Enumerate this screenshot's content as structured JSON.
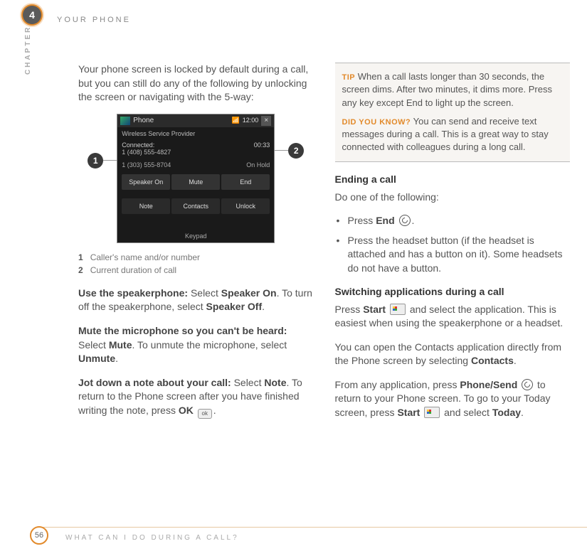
{
  "header": {
    "chapter_number": "4",
    "section_name": "YOUR PHONE",
    "chapter_label": "CHAPTER"
  },
  "left": {
    "intro": "Your phone screen is locked by default during a call, but you can still do any of the following by unlocking the screen or navigating with the 5-way:",
    "phone": {
      "title": "Phone",
      "clock": "12:00",
      "provider": "Wireless Service Provider",
      "connected_label": "Connected:",
      "duration": "00:33",
      "number_active": "1 (408) 555-4827",
      "number_held": "1 (303) 555-8704",
      "held_label": "On Hold",
      "buttons_row1": [
        "Speaker On",
        "Mute",
        "End"
      ],
      "buttons_row2": [
        "Note",
        "Contacts",
        "Unlock"
      ],
      "keypad_label": "Keypad"
    },
    "callouts": {
      "one": "1",
      "two": "2"
    },
    "legend": {
      "l1_num": "1",
      "l1_text": "Caller's name and/or number",
      "l2_num": "2",
      "l2_text": "Current duration of call"
    },
    "speaker_title": "Use the speakerphone:",
    "speaker_text_a": " Select ",
    "speaker_on": "Speaker On",
    "speaker_text_b": ". To turn off the speakerphone, select ",
    "speaker_off": "Speaker Off",
    "speaker_text_c": ".",
    "mute_title": "Mute the microphone so you can't be heard:",
    "mute_text_a": " Select ",
    "mute_on": "Mute",
    "mute_text_b": ". To unmute the microphone, select ",
    "mute_off": "Unmute",
    "mute_text_c": ".",
    "note_title": "Jot down a note about your call:",
    "note_text_a": " Select ",
    "note_on": "Note",
    "note_text_b": ". To return to the Phone screen after you have finished writing the note, press ",
    "note_ok": "OK",
    "note_text_c": " ",
    "note_text_d": "."
  },
  "right": {
    "tip_label": "TIP",
    "tip_text": "When a call lasts longer than 30 seconds, the screen dims. After two minutes, it dims more. Press any key except End to light up the screen.",
    "dyk_label": "DID YOU KNOW?",
    "dyk_text": "You can send and receive text messages during a call. This is a great way to stay connected with colleagues during a long call.",
    "end_heading": "Ending a call",
    "end_intro": "Do one of the following:",
    "end_b1_a": "Press ",
    "end_b1_bold": "End",
    "end_b1_b": " ",
    "end_b1_c": ".",
    "end_b2": "Press the headset button (if the headset is attached and has a button on it). Some headsets do not have a button.",
    "switch_heading": "Switching applications during a call",
    "switch_p1_a": "Press ",
    "switch_p1_start": "Start",
    "switch_p1_b": " ",
    "switch_p1_c": " and select the application. This is easiest when using the speakerphone or a headset.",
    "switch_p2_a": "You can open the Contacts application directly from the Phone screen by selecting ",
    "switch_p2_contacts": "Contacts",
    "switch_p2_b": ".",
    "switch_p3_a": "From any application, press ",
    "switch_p3_phone": "Phone/Send",
    "switch_p3_b": " ",
    "switch_p3_c": " to return to your Phone screen. To go to your Today screen, press ",
    "switch_p3_start": "Start",
    "switch_p3_d": " ",
    "switch_p3_e": " and select ",
    "switch_p3_today": "Today",
    "switch_p3_f": "."
  },
  "footer": {
    "page": "56",
    "title": "WHAT CAN I DO DURING A CALL?"
  }
}
